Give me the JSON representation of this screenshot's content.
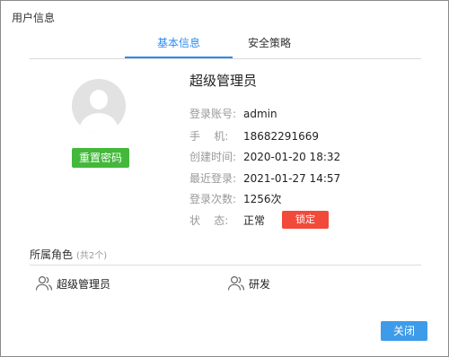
{
  "dialog": {
    "title": "用户信息"
  },
  "tabs": [
    {
      "label": "基本信息",
      "active": true
    },
    {
      "label": "安全策略",
      "active": false
    }
  ],
  "profile": {
    "name": "超级管理员",
    "reset_password_label": "重置密码",
    "fields": [
      {
        "label": "登录账号:",
        "value": "admin"
      },
      {
        "label": "手    机:",
        "value": "18682291669"
      },
      {
        "label": "创建时间:",
        "value": "2020-01-20 18:32"
      },
      {
        "label": "最近登录:",
        "value": "2021-01-27 14:57"
      },
      {
        "label": "登录次数:",
        "value": "1256次"
      },
      {
        "label": "状    态:",
        "value": "正常"
      }
    ],
    "lock_label": "锁定"
  },
  "roles": {
    "title": "所属角色",
    "count_text": "(共2个)",
    "items": [
      {
        "label": "超级管理员",
        "icon": "users-icon"
      },
      {
        "label": "研发",
        "icon": "users-icon"
      }
    ]
  },
  "footer": {
    "close_label": "关闭"
  },
  "colors": {
    "accent": "#2d8cf0",
    "reset_button": "#43b83a",
    "lock_button": "#f24a3a",
    "close_button": "#3d9be9"
  }
}
